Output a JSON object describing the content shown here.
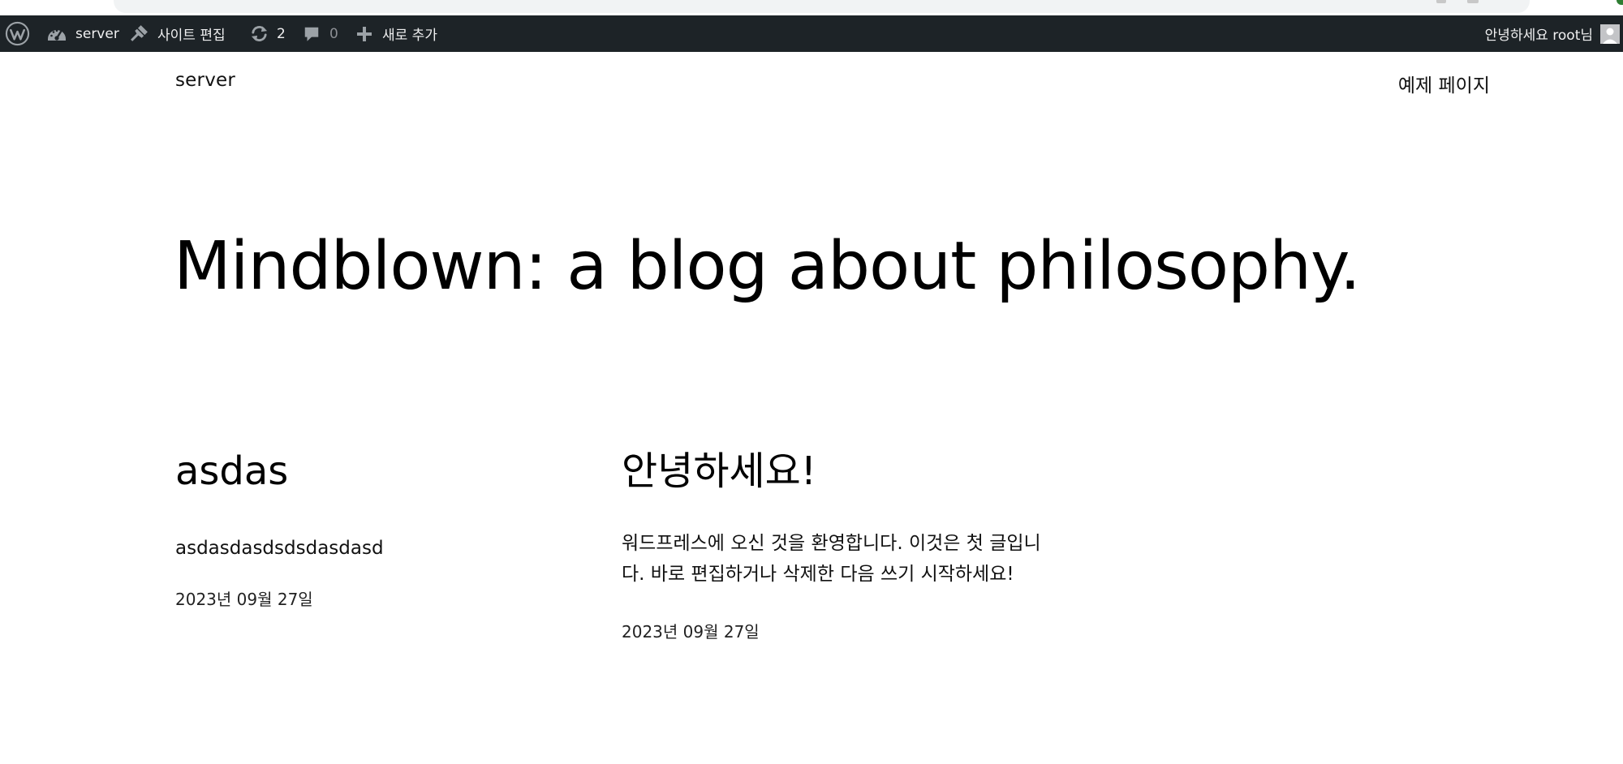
{
  "admin_bar": {
    "site_name": "server",
    "edit_site": "사이트 편집",
    "updates_count": "2",
    "comments_count": "0",
    "new_content": "새로 추가",
    "greeting": "안녕하세요 root님",
    "colors": {
      "background": "#1d2327",
      "text": "#f0f0f1",
      "muted": "#8c8f94"
    }
  },
  "header": {
    "site_title": "server",
    "nav": [
      {
        "label": "예제 페이지"
      }
    ]
  },
  "hero": {
    "title": "Mindblown: a blog about philosophy."
  },
  "posts": [
    {
      "title": "asdas",
      "excerpt": "asdasdasdsdsdasdasd",
      "date": "2023년 09월 27일"
    },
    {
      "title": "안녕하세요!",
      "excerpt": "워드프레스에 오신 것을 환영합니다. 이것은 첫 글입니다. 바로 편집하거나 삭제한 다음 쓰기 시작하세요!",
      "date": "2023년 09월 27일"
    }
  ],
  "icons": {
    "wp_logo": "wordpress-logo-icon",
    "dashboard": "dashboard-gauge-icon",
    "edit_site": "brush-icon",
    "updates": "updates-refresh-icon",
    "comments": "comment-bubble-icon",
    "new": "plus-icon",
    "avatar": "user-avatar-icon"
  }
}
